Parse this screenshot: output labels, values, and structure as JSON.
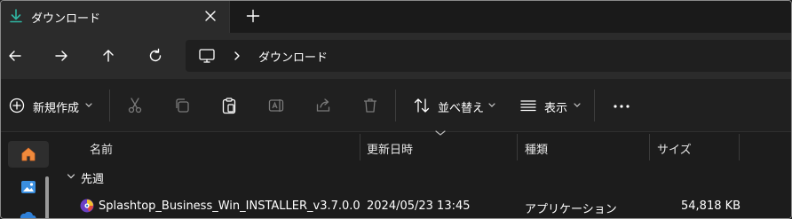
{
  "tab": {
    "title": "ダウンロード",
    "download_icon_color": "#2fb6a3",
    "close_icon": "close-icon",
    "new_tab_icon": "plus-icon"
  },
  "nav": {
    "back_icon": "arrow-left-icon",
    "forward_icon": "arrow-right-icon",
    "up_icon": "arrow-up-icon",
    "refresh_icon": "refresh-icon"
  },
  "address": {
    "location_icon": "monitor-icon",
    "crumb": "ダウンロード"
  },
  "commands": {
    "new_label": "新規作成",
    "sort_label": "並べ替え",
    "view_label": "表示",
    "more_icon": "more-icon",
    "icons": [
      "plus-circle-icon",
      "cut-icon",
      "copy-icon",
      "paste-icon",
      "rename-icon",
      "share-icon",
      "delete-icon",
      "sort-icon",
      "view-icon"
    ]
  },
  "columns": {
    "name": "名前",
    "date": "更新日時",
    "type": "種類",
    "size": "サイズ"
  },
  "groups": [
    {
      "label": "先週",
      "files": [
        {
          "name": "Splashtop_Business_Win_INSTALLER_v3.7.0.0",
          "date": "2024/05/23 13:45",
          "type": "アプリケーション",
          "size": "54,818 KB"
        }
      ]
    }
  ],
  "sidebar": {
    "icons": [
      "home-icon",
      "gallery-icon",
      "onedrive-icon"
    ]
  }
}
